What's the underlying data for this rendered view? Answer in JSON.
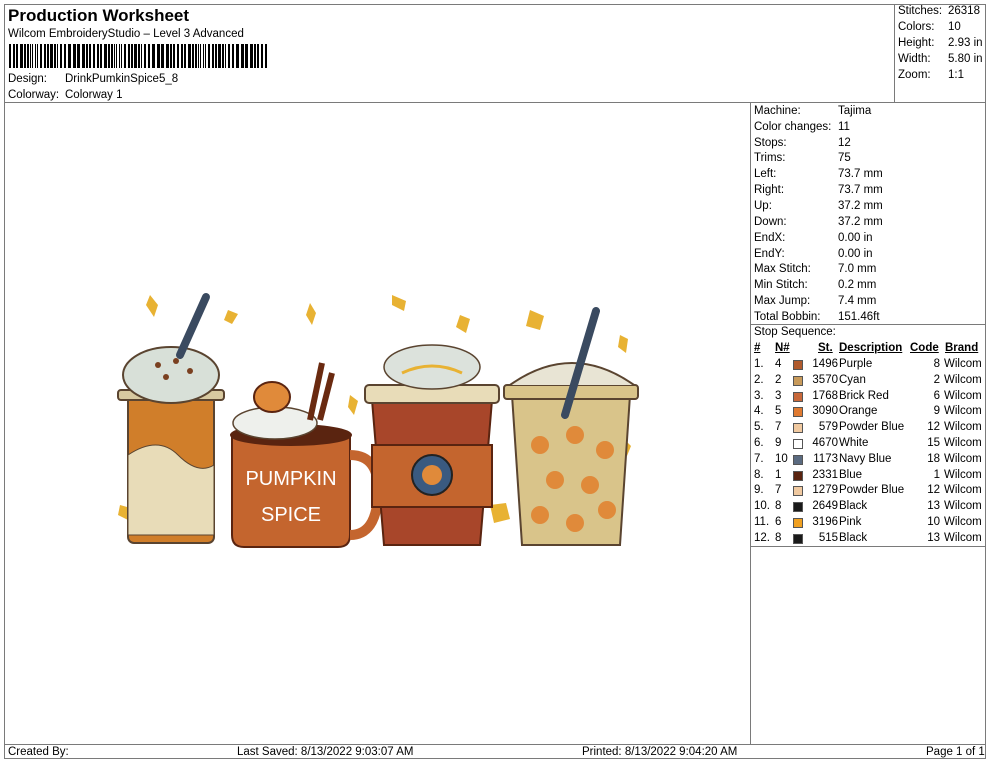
{
  "header": {
    "title": "Production Worksheet",
    "subtitle": "Wilcom EmbroideryStudio – Level 3 Advanced",
    "design_label": "Design:",
    "design_value": "DrinkPumkinSpice5_8",
    "colorway_label": "Colorway:",
    "colorway_value": "Colorway 1"
  },
  "stats": [
    {
      "label": "Stitches:",
      "value": "26318"
    },
    {
      "label": "Colors:",
      "value": "10"
    },
    {
      "label": "Height:",
      "value": "2.93 in"
    },
    {
      "label": "Width:",
      "value": "5.80 in"
    },
    {
      "label": "Zoom:",
      "value": "1:1"
    }
  ],
  "machine": [
    {
      "label": "Machine:",
      "value": "Tajima"
    },
    {
      "label": "Color changes:",
      "value": "11"
    },
    {
      "label": "Stops:",
      "value": "12"
    },
    {
      "label": "Trims:",
      "value": "75"
    },
    {
      "label": "Left:",
      "value": "73.7 mm"
    },
    {
      "label": "Right:",
      "value": "73.7 mm"
    },
    {
      "label": "Up:",
      "value": "37.2 mm"
    },
    {
      "label": "Down:",
      "value": "37.2 mm"
    },
    {
      "label": "EndX:",
      "value": "0.00 in"
    },
    {
      "label": "EndY:",
      "value": "0.00 in"
    },
    {
      "label": "Max Stitch:",
      "value": "7.0 mm"
    },
    {
      "label": "Min Stitch:",
      "value": "0.2 mm"
    },
    {
      "label": "Max Jump:",
      "value": "7.4 mm"
    },
    {
      "label": "Total Bobbin:",
      "value": "151.46ft"
    }
  ],
  "stop_sequence": {
    "title": "Stop Sequence:",
    "headers": [
      "#",
      "N#",
      "St.",
      "Description",
      "Code",
      "Brand"
    ],
    "rows": [
      {
        "num": "1.",
        "n": "4",
        "color": "#b05a2c",
        "st": "1496",
        "desc": "Purple",
        "code": "8",
        "brand": "Wilcom"
      },
      {
        "num": "2.",
        "n": "2",
        "color": "#c89a5a",
        "st": "3570",
        "desc": "Cyan",
        "code": "2",
        "brand": "Wilcom"
      },
      {
        "num": "3.",
        "n": "3",
        "color": "#c8683a",
        "st": "1768",
        "desc": "Brick Red",
        "code": "6",
        "brand": "Wilcom"
      },
      {
        "num": "4.",
        "n": "5",
        "color": "#e07a30",
        "st": "3090",
        "desc": "Orange",
        "code": "9",
        "brand": "Wilcom"
      },
      {
        "num": "5.",
        "n": "7",
        "color": "#f0c9a0",
        "st": "579",
        "desc": "Powder Blue",
        "code": "12",
        "brand": "Wilcom"
      },
      {
        "num": "6.",
        "n": "9",
        "color": "#ffffff",
        "st": "4670",
        "desc": "White",
        "code": "15",
        "brand": "Wilcom"
      },
      {
        "num": "7.",
        "n": "10",
        "color": "#5a6a80",
        "st": "1173",
        "desc": "Navy Blue",
        "code": "18",
        "brand": "Wilcom"
      },
      {
        "num": "8.",
        "n": "1",
        "color": "#5a2410",
        "st": "2331",
        "desc": "Blue",
        "code": "1",
        "brand": "Wilcom"
      },
      {
        "num": "9.",
        "n": "7",
        "color": "#f0c9a0",
        "st": "1279",
        "desc": "Powder Blue",
        "code": "12",
        "brand": "Wilcom"
      },
      {
        "num": "10.",
        "n": "8",
        "color": "#1a1a1a",
        "st": "2649",
        "desc": "Black",
        "code": "13",
        "brand": "Wilcom"
      },
      {
        "num": "11.",
        "n": "6",
        "color": "#f0a020",
        "st": "3196",
        "desc": "Pink",
        "code": "10",
        "brand": "Wilcom"
      },
      {
        "num": "12.",
        "n": "8",
        "color": "#1a1a1a",
        "st": "515",
        "desc": "Black",
        "code": "13",
        "brand": "Wilcom"
      }
    ]
  },
  "design_image": {
    "mug_text_line1": "PUMPKIN",
    "mug_text_line2": "SPICE"
  },
  "footer": {
    "created_by": "Created By:",
    "last_saved": "Last Saved: 8/13/2022 9:03:07 AM",
    "printed": "Printed: 8/13/2022 9:04:20 AM",
    "page": "Page 1 of 1"
  }
}
